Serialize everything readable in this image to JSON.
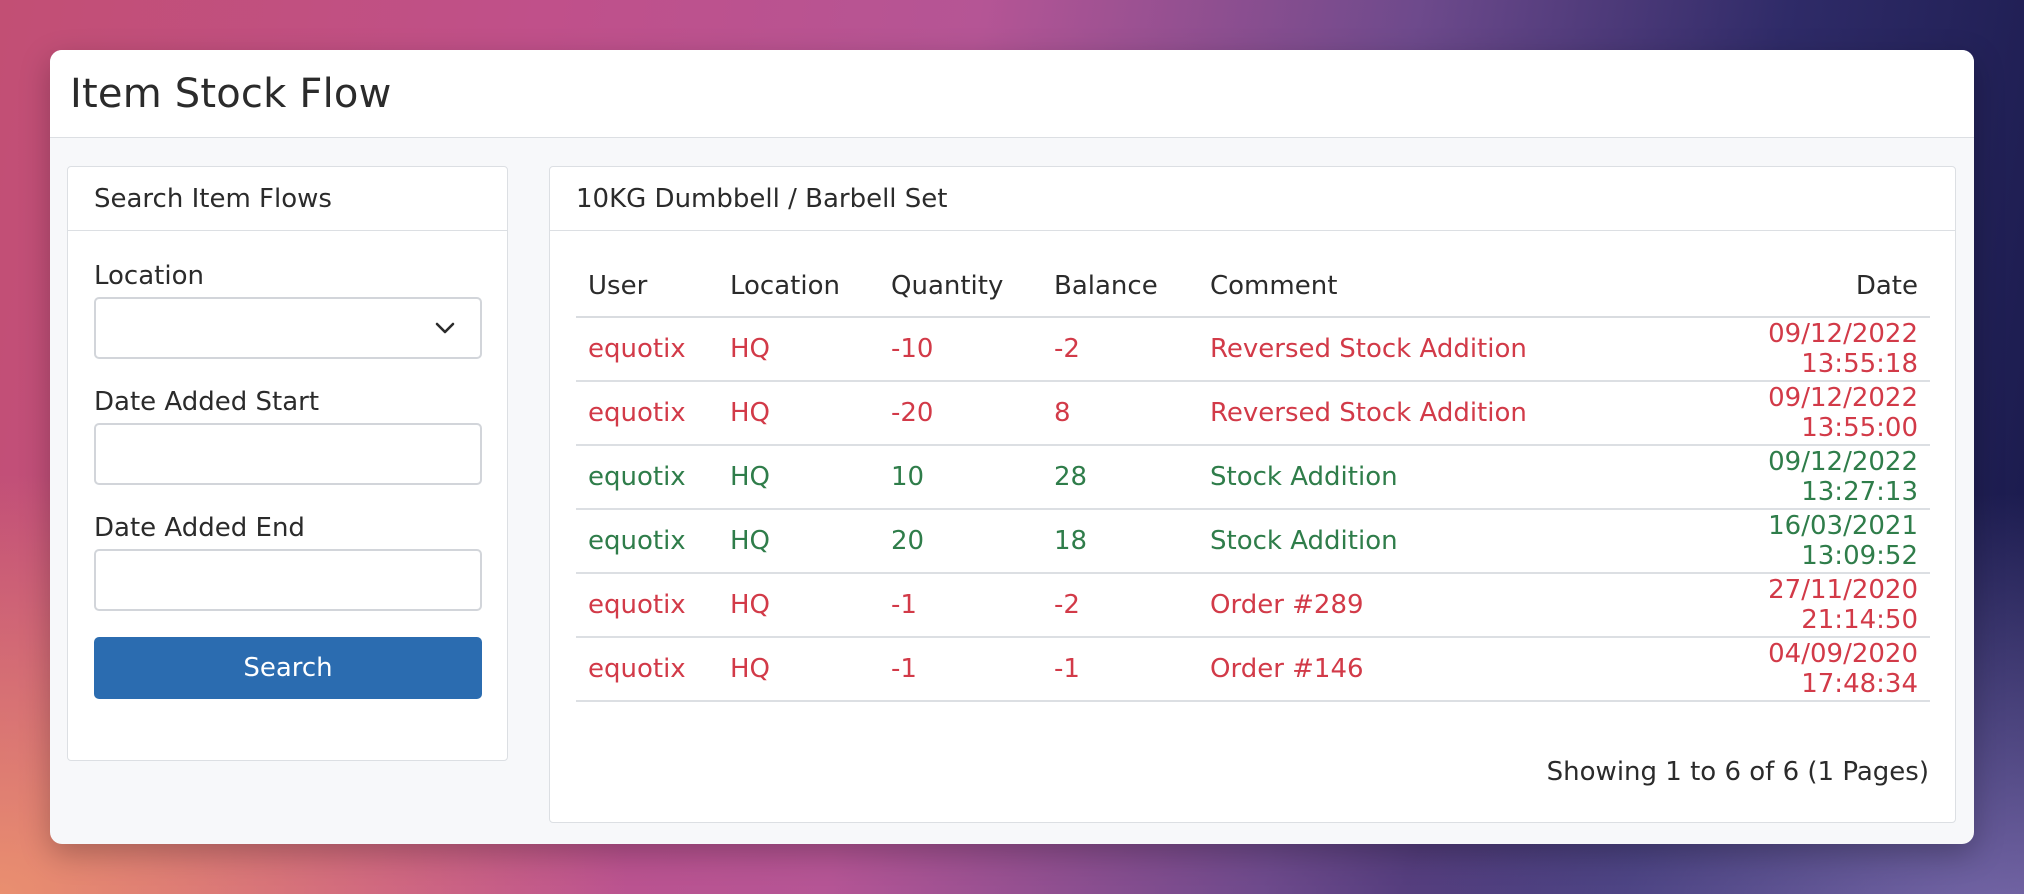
{
  "page": {
    "title": "Item Stock Flow"
  },
  "search": {
    "header": "Search Item Flows",
    "location_label": "Location",
    "location_value": "",
    "date_start_label": "Date Added Start",
    "date_start_value": "",
    "date_end_label": "Date Added End",
    "date_end_value": "",
    "button_label": "Search"
  },
  "results": {
    "header": "10KG Dumbbell / Barbell Set",
    "columns": [
      "User",
      "Location",
      "Quantity",
      "Balance",
      "Comment",
      "Date"
    ],
    "rows": [
      {
        "user": "equotix",
        "location": "HQ",
        "quantity": "-10",
        "balance": "-2",
        "comment": "Reversed Stock Addition",
        "date": "09/12/2022 13:55:18",
        "status": "negative"
      },
      {
        "user": "equotix",
        "location": "HQ",
        "quantity": "-20",
        "balance": "8",
        "comment": "Reversed Stock Addition",
        "date": "09/12/2022 13:55:00",
        "status": "negative"
      },
      {
        "user": "equotix",
        "location": "HQ",
        "quantity": "10",
        "balance": "28",
        "comment": "Stock Addition",
        "date": "09/12/2022 13:27:13",
        "status": "positive"
      },
      {
        "user": "equotix",
        "location": "HQ",
        "quantity": "20",
        "balance": "18",
        "comment": "Stock Addition",
        "date": "16/03/2021 13:09:52",
        "status": "positive"
      },
      {
        "user": "equotix",
        "location": "HQ",
        "quantity": "-1",
        "balance": "-2",
        "comment": "Order #289",
        "date": "27/11/2020 21:14:50",
        "status": "negative"
      },
      {
        "user": "equotix",
        "location": "HQ",
        "quantity": "-1",
        "balance": "-1",
        "comment": "Order #146",
        "date": "04/09/2020 17:48:34",
        "status": "negative"
      }
    ],
    "pagination_text": "Showing 1 to 6 of 6 (1 Pages)"
  },
  "colors": {
    "negative": "#d23a48",
    "positive": "#2f7d4a",
    "button": "#2b6cb0"
  },
  "icons": {
    "location_dropdown": "chevron-down-icon"
  }
}
